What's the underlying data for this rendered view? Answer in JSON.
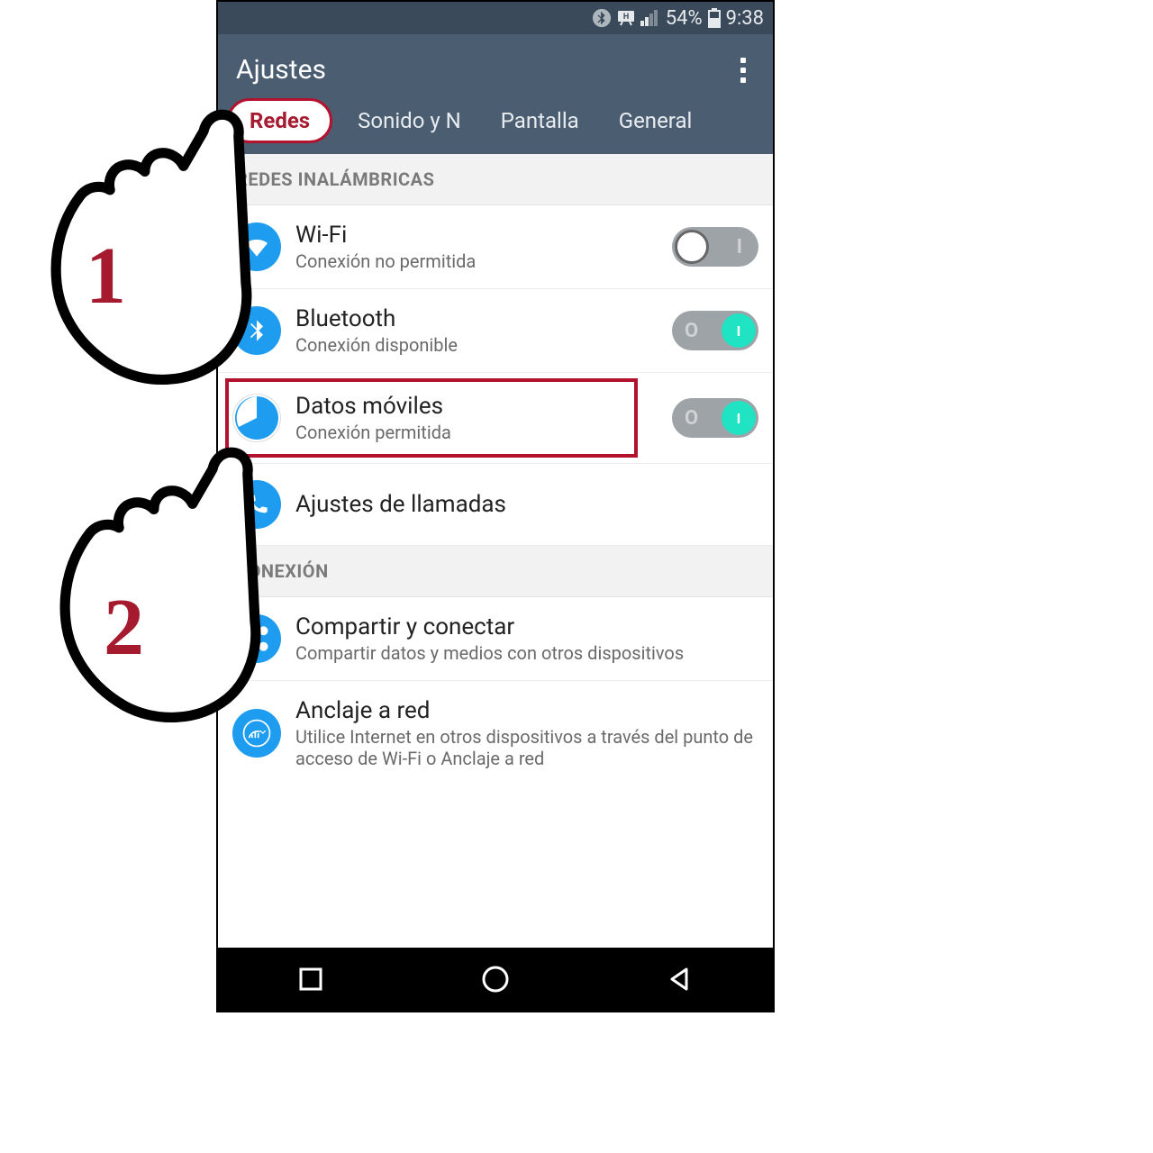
{
  "status": {
    "battery": "54%",
    "time": "9:38"
  },
  "header": {
    "title": "Ajustes"
  },
  "tabs": [
    "Redes",
    "Sonido y N",
    "Pantalla",
    "General"
  ],
  "sections": {
    "wireless_header": "REDES INALÁMBRICAS",
    "connection_header": "CONEXIÓN"
  },
  "rows": {
    "wifi": {
      "title": "Wi-Fi",
      "sub": "Conexión no permitida"
    },
    "bluetooth": {
      "title": "Bluetooth",
      "sub": "Conexión disponible"
    },
    "data": {
      "title": "Datos móviles",
      "sub": "Conexión permitida"
    },
    "calls": {
      "title": "Ajustes de llamadas",
      "sub": ""
    },
    "share": {
      "title": "Compartir y conectar",
      "sub": "Compartir datos y medios con otros dispositivos"
    },
    "tether": {
      "title": "Anclaje a red",
      "sub": "Utilice Internet en otros dispositivos a través del punto de acceso de Wi-Fi o Anclaje a red"
    }
  },
  "annotations": {
    "step1": "1",
    "step2": "2"
  },
  "colors": {
    "accent": "#b3122e",
    "header": "#4b5d71",
    "toggle_on": "#1fe3c2",
    "icon": "#1e9df0"
  }
}
